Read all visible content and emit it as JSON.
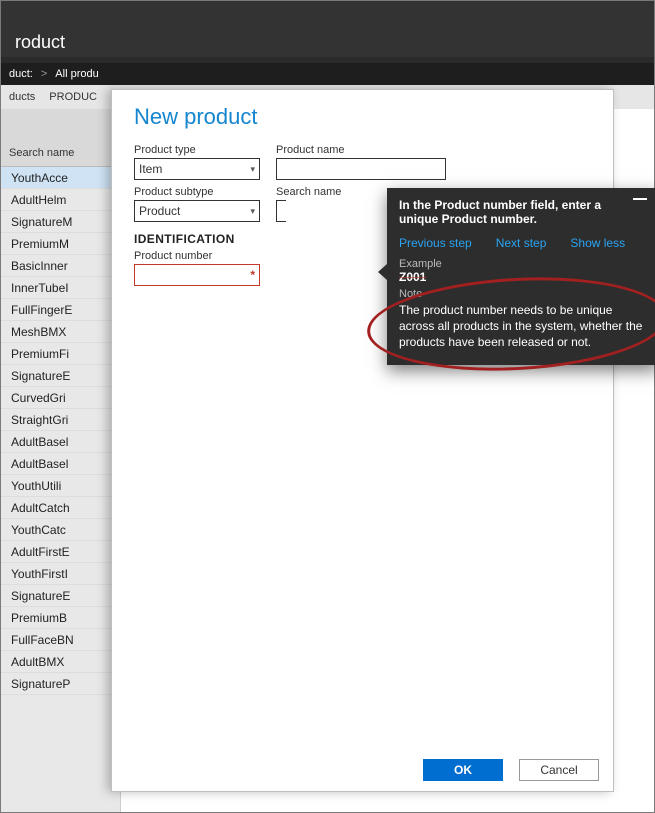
{
  "header": {
    "title": "roduct"
  },
  "breadcrumb": {
    "item1": "duct:",
    "sep": ">",
    "item2": "All produ"
  },
  "nav": {
    "tab1": "ducts",
    "tab2": "PRODUC"
  },
  "grid": {
    "header": "Search name",
    "rows": [
      "YouthAcce",
      "AdultHelm",
      "SignatureM",
      "PremiumM",
      "BasicInner",
      "InnerTubeI",
      "FullFingerE",
      "MeshBMX",
      "PremiumFi",
      "SignatureE",
      "CurvedGri",
      "StraightGri",
      "AdultBasel",
      "AdultBasel",
      "YouthUtili",
      "AdultCatch",
      "YouthCatc",
      "AdultFirstE",
      "YouthFirstI",
      "SignatureE",
      "PremiumB",
      "FullFaceBN",
      "AdultBMX",
      "SignatureP"
    ]
  },
  "panel": {
    "title": "New product",
    "productTypeLabel": "Product type",
    "productTypeValue": "Item",
    "productNameLabel": "Product name",
    "productSubtypeLabel": "Product subtype",
    "productSubtypeValue": "Product",
    "searchNameLabel": "Search name",
    "identificationHeader": "IDENTIFICATION",
    "productNumberLabel": "Product number"
  },
  "tooltip": {
    "title": "In the Product number field, enter a unique Product number.",
    "prevStep": "Previous step",
    "nextStep": "Next step",
    "showLess": "Show less",
    "exampleLabel": "Example",
    "exampleValue": "Z001",
    "noteLabel": "Note",
    "noteText": "The product number needs to be unique across all products in the system, whether the products have been released or not."
  },
  "buttons": {
    "ok": "OK",
    "cancel": "Cancel"
  }
}
